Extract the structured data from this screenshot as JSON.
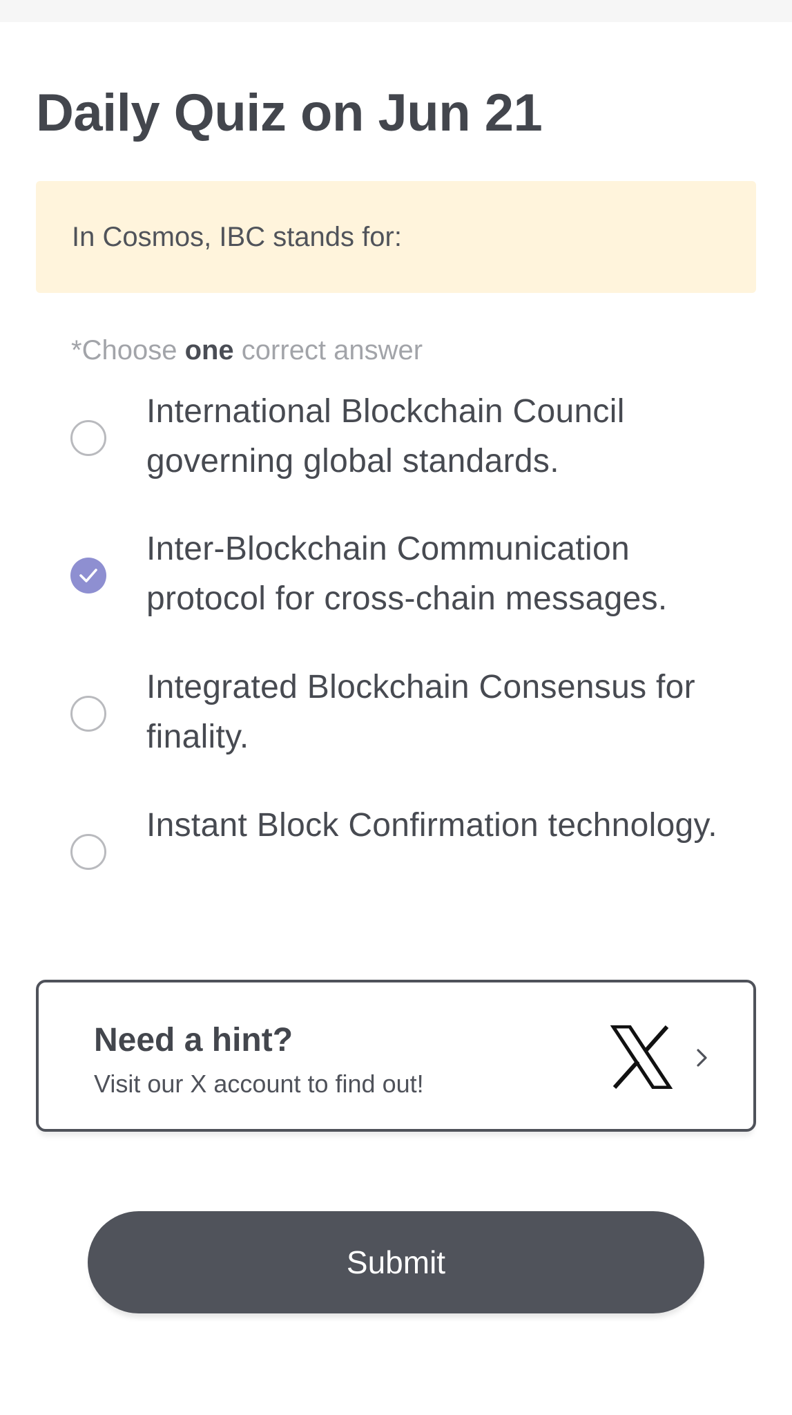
{
  "page": {
    "title": "Daily Quiz on Jun 21"
  },
  "question": {
    "text": "In Cosmos, IBC stands for:"
  },
  "instructions": {
    "prefix": "*Choose ",
    "emphasis": "one",
    "suffix": " correct answer"
  },
  "options": [
    {
      "label": "International Blockchain Council governing global standards.",
      "selected": false
    },
    {
      "label": "Inter-Blockchain Communication protocol for cross-chain messages.",
      "selected": true
    },
    {
      "label": "Integrated Blockchain Consensus for finality.",
      "selected": false
    },
    {
      "label": "Instant Block Confirmation technology.",
      "selected": false
    }
  ],
  "hint": {
    "title": "Need a hint?",
    "subtitle": "Visit our X account to find out!",
    "icon": "x-logo-icon",
    "chevron": "chevron-right-icon"
  },
  "submit": {
    "label": "Submit"
  },
  "colors": {
    "accent": "#8e8fd1",
    "question_bg": "#fff4dc",
    "button_bg": "#50535b",
    "text_primary": "#43464d",
    "text_muted": "#a2a4a9"
  }
}
